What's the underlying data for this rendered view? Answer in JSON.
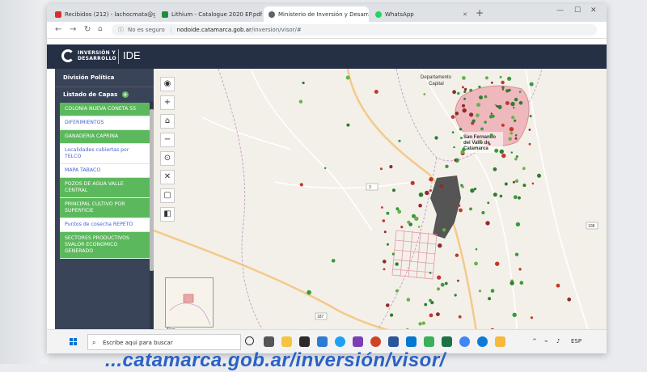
{
  "browser": {
    "tabs": [
      {
        "label": "Recibidos (212) - lachocmata@g...",
        "favicon_color": "#d93025",
        "active": false
      },
      {
        "label": "Lithium - Catalogue 2020 EP.pdf",
        "favicon_color": "#1e8e3e",
        "active": false
      },
      {
        "label": "Ministerio de Inversión y Desarr...",
        "favicon_color": "#5f6368",
        "active": true
      },
      {
        "label": "WhatsApp",
        "favicon_color": "#25d366",
        "active": false
      }
    ],
    "new_tab": "+",
    "url_security": "No es seguro",
    "url_host": "nodoide.catamarca.gob.ar",
    "url_path": "/inversion/visor/#"
  },
  "app": {
    "brand_line1": "INVERSIÓN Y",
    "brand_line2": "DESARROLLO",
    "brand_ide": "IDE"
  },
  "sidebar": {
    "title": "División Política",
    "subtitle": "Listado de Capas",
    "layers": [
      {
        "label": "COLONIA NUEVA CONETA 55",
        "active": true
      },
      {
        "label": "DIFERIMIENTOS",
        "active": false
      },
      {
        "label": "GANADERIA CAPRINA",
        "active": true
      },
      {
        "label": "Localidades cubiertas por TELCO",
        "active": false
      },
      {
        "label": "MAPA TABACO",
        "active": false
      },
      {
        "label": "POZOS DE AGUA VALLE CENTRAL",
        "active": true
      },
      {
        "label": "PRINCIPAL CULTIVO POR SUPERFICIE",
        "active": true
      },
      {
        "label": "Puntos de cosecha REPETO",
        "active": false
      },
      {
        "label": "SECTORES PRODUCTIVOS SVALOR ECONOMICO GENERADO",
        "active": true
      }
    ]
  },
  "map": {
    "labels": {
      "departamento": "Departamento",
      "capital": "Capital",
      "city_1": "San Fernando",
      "city_2": "del Valle de",
      "city_3": "Catamarca"
    },
    "scale": "5km"
  },
  "taskbar": {
    "search_placeholder": "Escribe aquí para buscar",
    "tray": "ESP"
  },
  "caption": "...catamarca.gob.ar/inversión/visor/"
}
